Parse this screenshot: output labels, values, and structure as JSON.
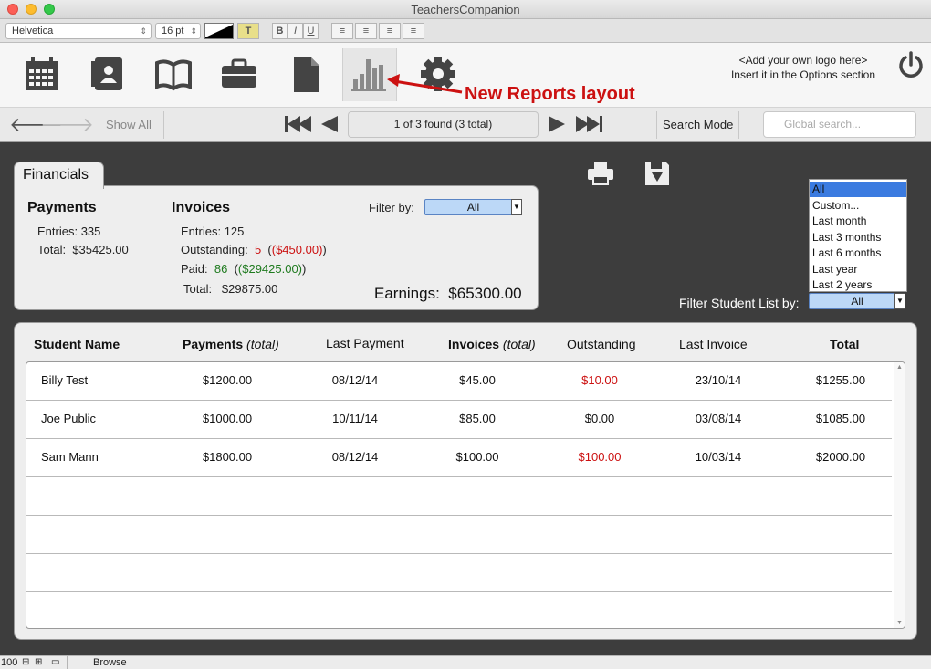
{
  "window": {
    "title": "TeachersCompanion"
  },
  "format_bar": {
    "font": "Helvetica",
    "size": "16 pt",
    "bold": "B",
    "italic": "I",
    "underline": "U",
    "text_color": "T"
  },
  "toolbar": {
    "icons": [
      "calendar-icon",
      "contacts-icon",
      "book-icon",
      "briefcase-icon",
      "document-icon",
      "reports-icon",
      "gear-icon"
    ],
    "annotation": "New Reports layout",
    "logo_line1": "<Add your own logo here>",
    "logo_line2": "Insert it in the Options section"
  },
  "navbar": {
    "show_all": "Show All",
    "record_status": "1 of 3 found (3 total)",
    "search_mode": "Search Mode",
    "global_search_placeholder": "Global search..."
  },
  "financials": {
    "tab_label": "Financials",
    "payments": {
      "title": "Payments",
      "entries_label": "Entries:",
      "entries": "335",
      "total_label": "Total:",
      "total": "$35425.00"
    },
    "invoices": {
      "title": "Invoices",
      "entries_label": "Entries:",
      "entries": "125",
      "outstanding_label": "Outstanding:",
      "outstanding_count": "5",
      "outstanding_amount": "($450.00)",
      "paid_label": "Paid:",
      "paid_count": "86",
      "paid_amount": "($29425.00)",
      "total_label": "Total:",
      "total": "$29875.00"
    },
    "filter_label": "Filter by:",
    "filter_value": "All",
    "earnings_label": "Earnings:",
    "earnings": "$65300.00"
  },
  "student_filter": {
    "label": "Filter Student List by:",
    "value": "All",
    "options": [
      "All",
      "Custom...",
      "Last month",
      "Last 3 months",
      "Last 6 months",
      "Last year",
      "Last 2 years"
    ]
  },
  "table": {
    "headers": {
      "student": "Student Name",
      "payments": "Payments",
      "payments_sub": "(total)",
      "last_payment": "Last Payment",
      "invoices": "Invoices",
      "invoices_sub": "(total)",
      "outstanding": "Outstanding",
      "last_invoice": "Last Invoice",
      "total": "Total"
    },
    "rows": [
      {
        "name": "Billy Test",
        "payments": "$1200.00",
        "last_payment": "08/12/14",
        "invoices": "$45.00",
        "outstanding": "$10.00",
        "outstanding_red": true,
        "last_invoice": "23/10/14",
        "total": "$1255.00"
      },
      {
        "name": "Joe Public",
        "payments": "$1000.00",
        "last_payment": "10/11/14",
        "invoices": "$85.00",
        "outstanding": "$0.00",
        "outstanding_red": false,
        "last_invoice": "03/08/14",
        "total": "$1085.00"
      },
      {
        "name": "Sam Mann",
        "payments": "$1800.00",
        "last_payment": "08/12/14",
        "invoices": "$100.00",
        "outstanding": "$100.00",
        "outstanding_red": true,
        "last_invoice": "10/03/14",
        "total": "$2000.00"
      }
    ]
  },
  "statusbar": {
    "zoom": "100",
    "mode": "Browse"
  },
  "colors": {
    "accent_red": "#cc1111",
    "green": "#1e7a1e",
    "selection_blue": "#bcd8f7"
  }
}
